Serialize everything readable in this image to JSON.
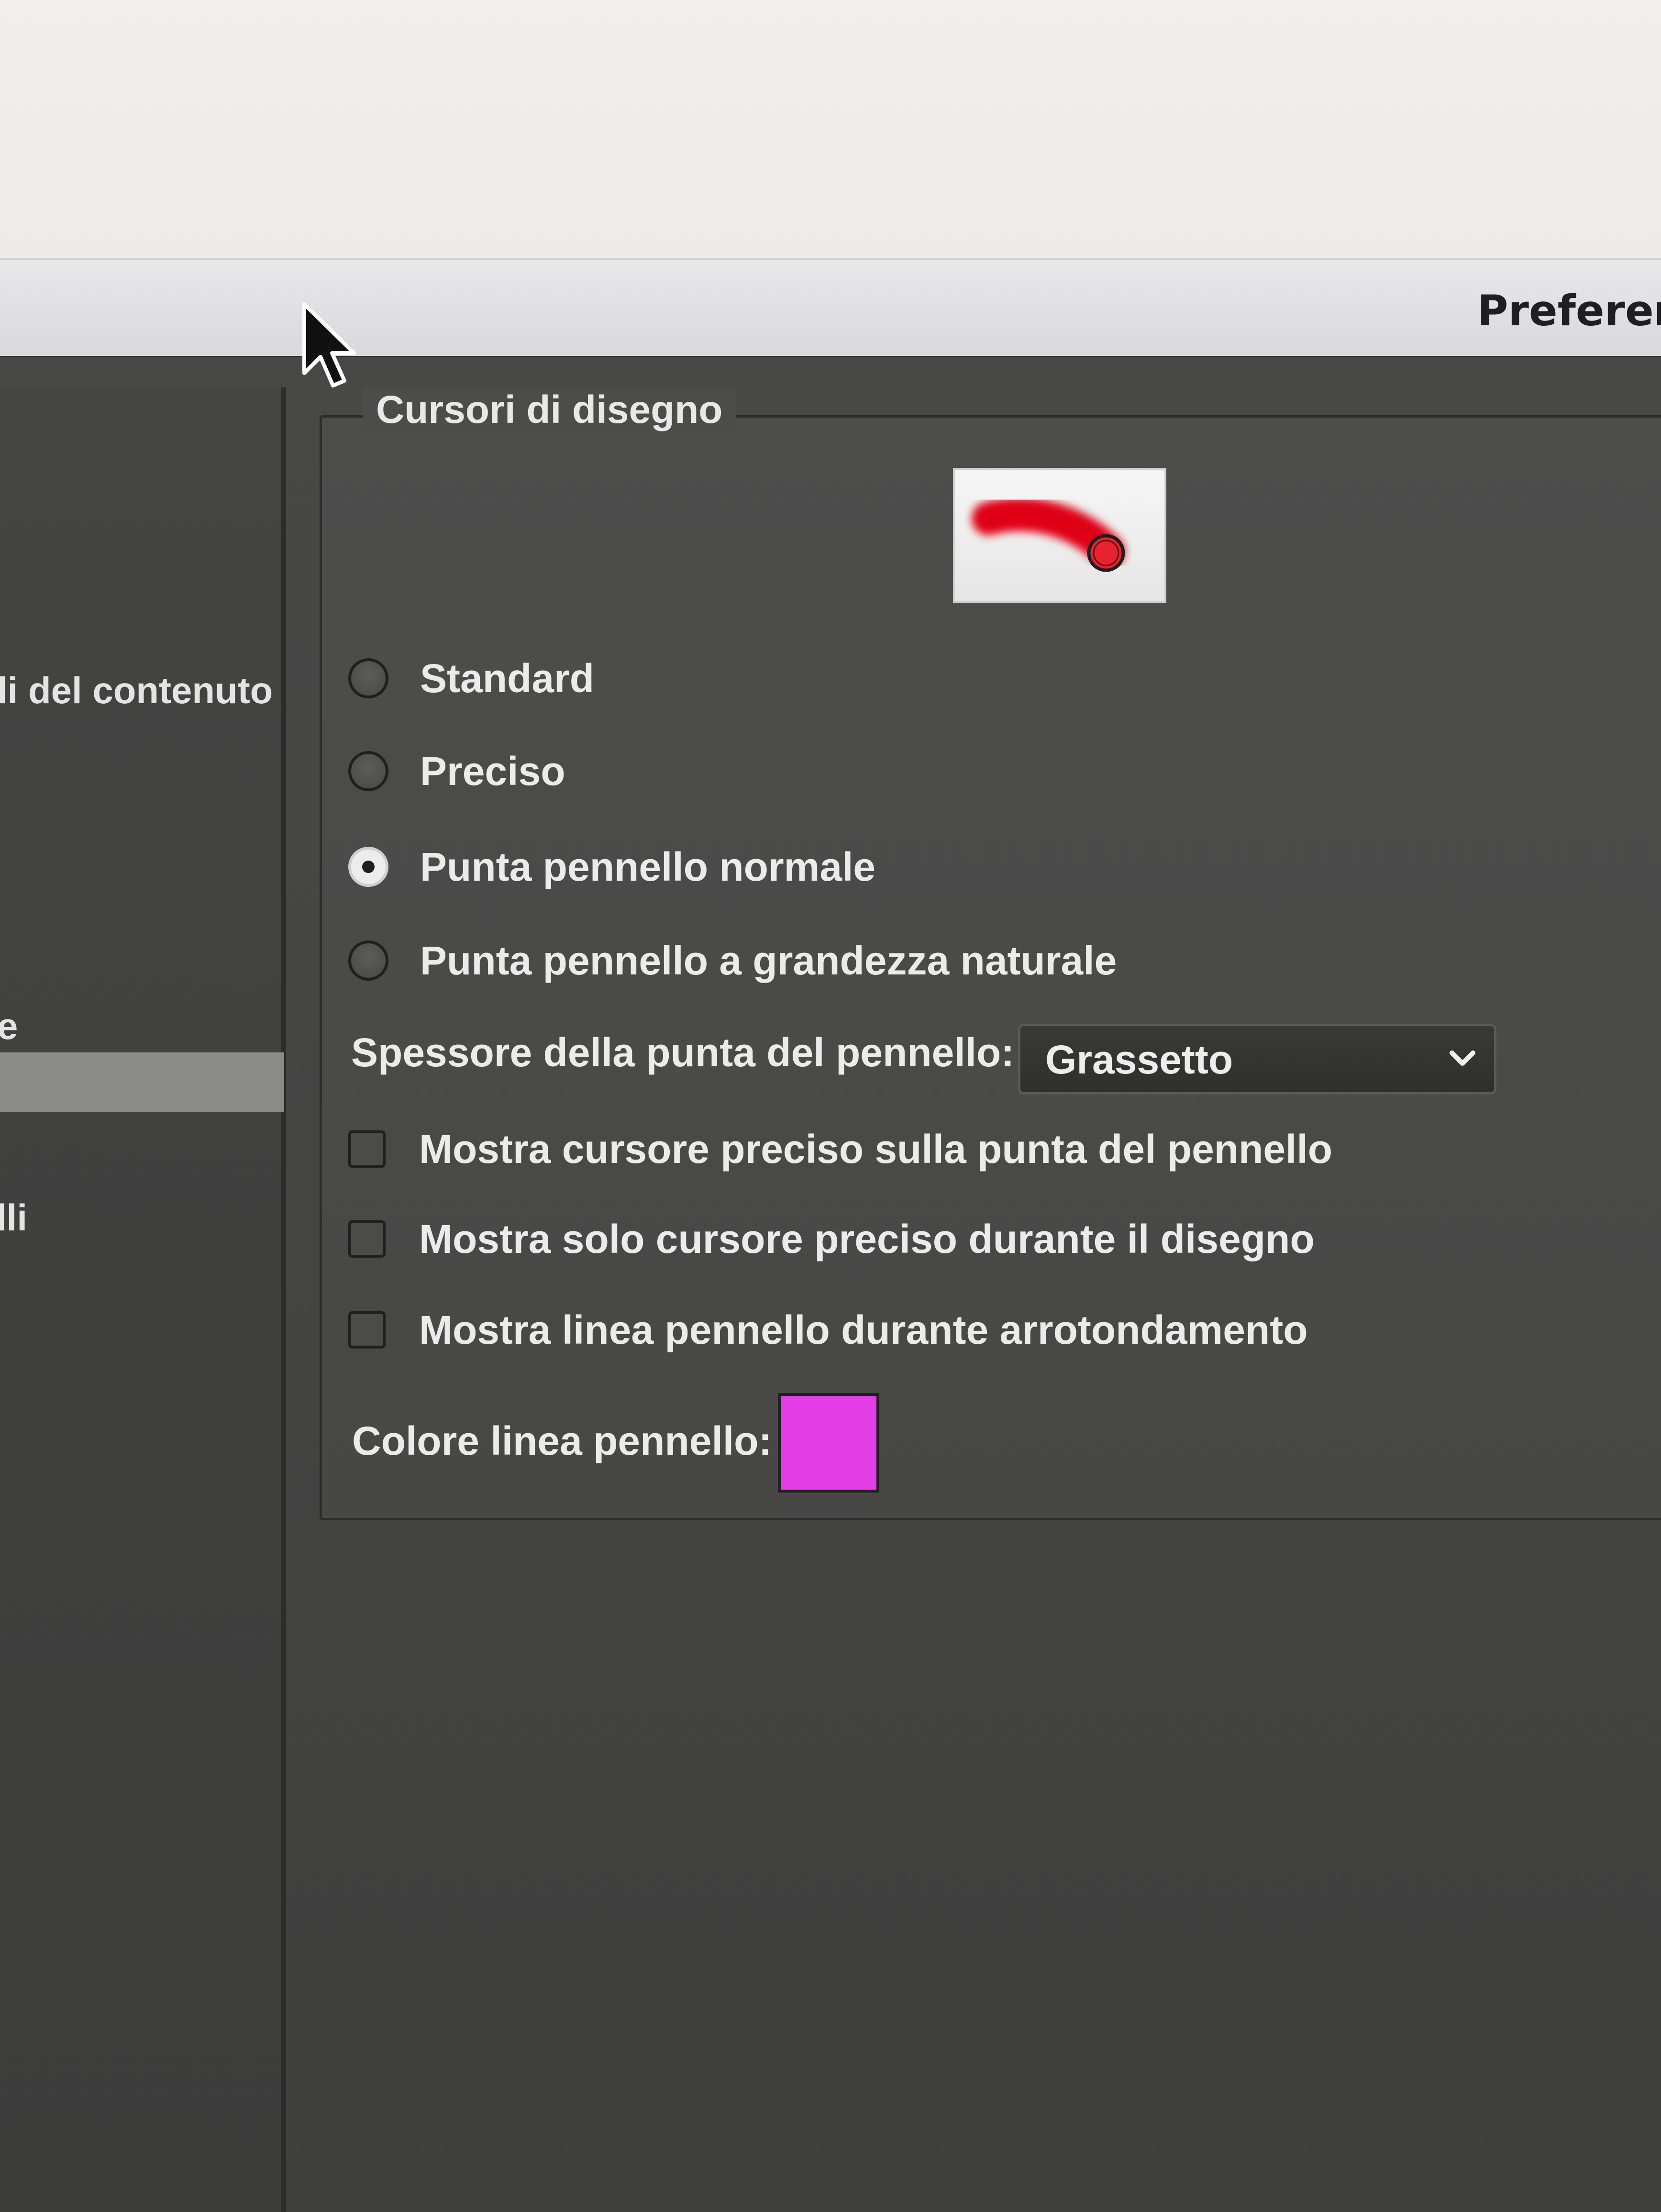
{
  "window": {
    "title": "Preferen"
  },
  "sidebar": {
    "items": [
      {
        "label": "li del contenuto"
      },
      {
        "label": "e"
      },
      {
        "label": "lli"
      }
    ]
  },
  "drawing_cursors": {
    "group_title": "Cursori di disegno",
    "options": [
      {
        "label": "Standard",
        "selected": false
      },
      {
        "label": "Preciso",
        "selected": false
      },
      {
        "label": "Punta pennello normale",
        "selected": true
      },
      {
        "label": "Punta pennello a grandezza naturale",
        "selected": false
      }
    ],
    "thickness": {
      "label": "Spessore della punta del pennello:",
      "value": "Grassetto"
    },
    "checkboxes": [
      {
        "label": "Mostra cursore preciso sulla punta del pennello",
        "checked": false
      },
      {
        "label": "Mostra solo cursore preciso durante il disegno",
        "checked": false
      },
      {
        "label": "Mostra linea pennello durante arrotondamento",
        "checked": false
      }
    ],
    "brush_line_color": {
      "label": "Colore linea pennello:",
      "color": "#e33ee6"
    }
  },
  "colors": {
    "preview_stroke": "#e00019"
  }
}
